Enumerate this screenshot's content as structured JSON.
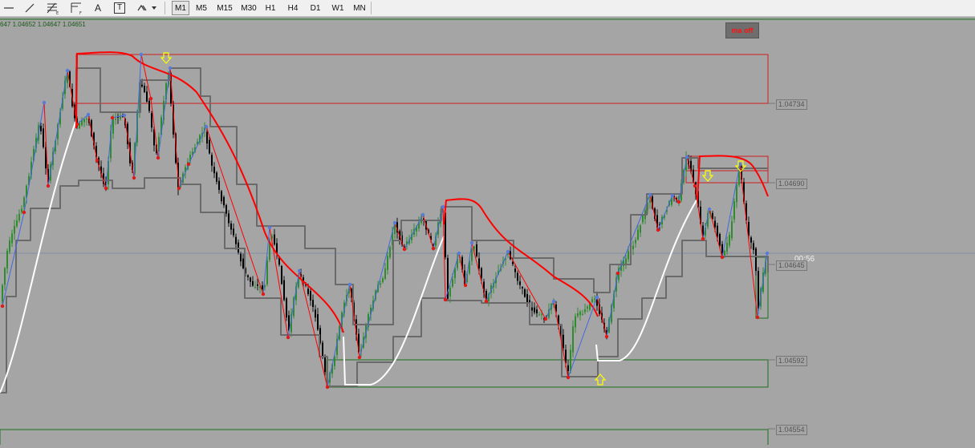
{
  "toolbar": {
    "tools": [
      {
        "name": "horizontal-line-icon"
      },
      {
        "name": "trendline-icon"
      },
      {
        "name": "fibonacci-icon"
      },
      {
        "name": "fibonacci-fan-icon"
      },
      {
        "name": "text-icon",
        "glyph": "A"
      },
      {
        "name": "text-label-icon",
        "glyph": "T"
      },
      {
        "name": "shapes-dropdown-icon"
      }
    ],
    "timeframes": [
      "M1",
      "M5",
      "M15",
      "M30",
      "H1",
      "H4",
      "D1",
      "W1",
      "MN"
    ],
    "active_timeframe": "M1"
  },
  "chart": {
    "ohlc_text": "647 1.04652 1.04647 1.04651",
    "ma_button": "ma off",
    "countdown": "00:56",
    "price_labels": [
      {
        "text": "1.04734",
        "price": 1.04734
      },
      {
        "text": "1.04690",
        "price": 1.0469
      },
      {
        "text": "1.04645",
        "price": 1.04645
      },
      {
        "text": "1.04592",
        "price": 1.04592
      },
      {
        "text": "1.04554",
        "price": 1.04554
      }
    ],
    "colors": {
      "background": "#a5a5a5",
      "bull": "#2e8b2e",
      "bear": "#000000",
      "ma": "#ff0000",
      "envelope": "#6a6a6a",
      "trail": "#ffffff",
      "zigzag_up": "#4169e1",
      "zigzag_down": "#ff0000",
      "arrow": "#ffff00",
      "support_box": "#1a6e1a",
      "resist_box": "#d02020"
    }
  }
}
